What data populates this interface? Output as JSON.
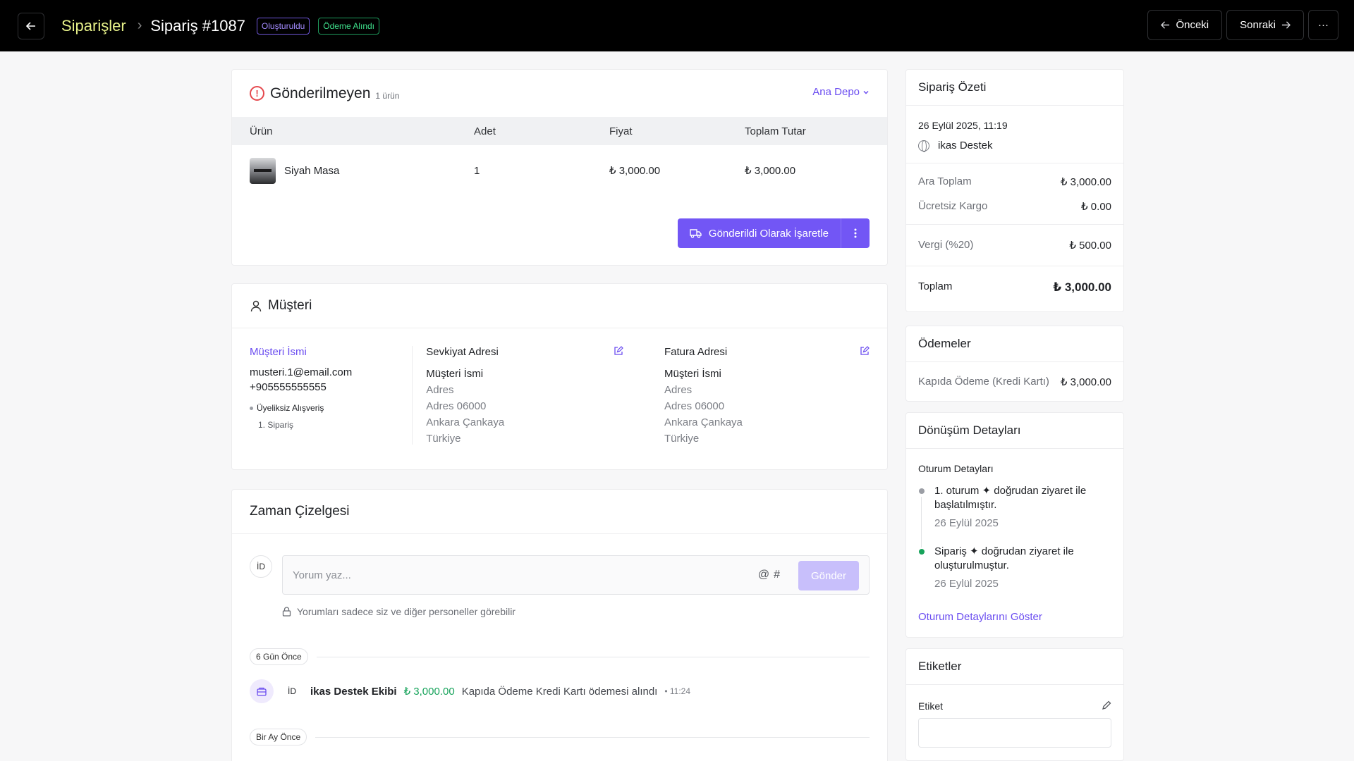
{
  "header": {
    "breadcrumb": "Siparişler",
    "order_title": "Sipariş #1087",
    "badge_created": "Oluşturuldu",
    "badge_paid": "Ödeme Alındı",
    "prev_label": "Önceki",
    "next_label": "Sonraki",
    "more_label": "···"
  },
  "unfulfilled": {
    "title": "Gönderilmeyen",
    "count": "1 ürün",
    "warehouse": "Ana Depo",
    "columns": [
      "Ürün",
      "Adet",
      "Fiyat",
      "Toplam Tutar"
    ],
    "rows": [
      {
        "product": "Siyah Masa",
        "qty": "1",
        "price": "₺ 3,000.00",
        "total": "₺ 3,000.00"
      }
    ],
    "fulfil_label": "Gönderildi Olarak İşaretle"
  },
  "customer": {
    "title": "Müşteri",
    "name": "Müşteri İsmi",
    "email": "musteri.1@email.com",
    "phone": "+905555555555",
    "guest": "Üyeliksiz Alışveriş",
    "order_count": "1. Sipariş",
    "shipping": {
      "title": "Sevkiyat Adresi",
      "name": "Müşteri İsmi",
      "lines": [
        "Adres",
        "Adres 06000",
        "Ankara Çankaya",
        "Türkiye"
      ]
    },
    "billing": {
      "title": "Fatura Adresi",
      "name": "Müşteri İsmi",
      "lines": [
        "Adres",
        "Adres 06000",
        "Ankara Çankaya",
        "Türkiye"
      ]
    }
  },
  "timeline": {
    "title": "Zaman Çizelgesi",
    "avatar": "İD",
    "placeholder": "Yorum yaz...",
    "mention_icons": "@#",
    "send_label": "Gönder",
    "privacy": "Yorumları sadece siz ve diğer personeller görebilir",
    "group1": "6 Gün Önce",
    "event": {
      "avatar": "İD",
      "actor": "ikas Destek Ekibi",
      "amount": "₺ 3,000.00",
      "text": "Kapıda Ödeme Kredi Kartı ödemesi alındı",
      "time": "• 11:24"
    },
    "group2": "Bir Ay Önce"
  },
  "summary": {
    "title": "Sipariş Özeti",
    "date": "26 Eylül 2025, 11:19",
    "channel": "ikas Destek",
    "subtotal_label": "Ara Toplam",
    "subtotal_value": "₺ 3,000.00",
    "shipping_label": "Ücretsiz Kargo",
    "shipping_value": "₺ 0.00",
    "tax_label": "Vergi (%20)",
    "tax_value": "₺ 500.00",
    "total_label": "Toplam",
    "total_value": "₺ 3,000.00"
  },
  "payments": {
    "title": "Ödemeler",
    "method": "Kapıda Ödeme (Kredi Kartı)",
    "amount": "₺ 3,000.00"
  },
  "conversion": {
    "title": "Dönüşüm Detayları",
    "subtitle": "Oturum Detayları",
    "items": [
      {
        "text": "1. oturum ✦ doğrudan ziyaret ile başlatılmıştır.",
        "date": "26 Eylül 2025",
        "color": "#9b9ea5"
      },
      {
        "text": "Sipariş ✦ doğrudan ziyaret ile oluşturulmuştur.",
        "date": "26 Eylül 2025",
        "color": "#17a35b"
      }
    ],
    "link": "Oturum Detaylarını Göster"
  },
  "tags": {
    "title": "Etiketler",
    "label": "Etiket"
  }
}
